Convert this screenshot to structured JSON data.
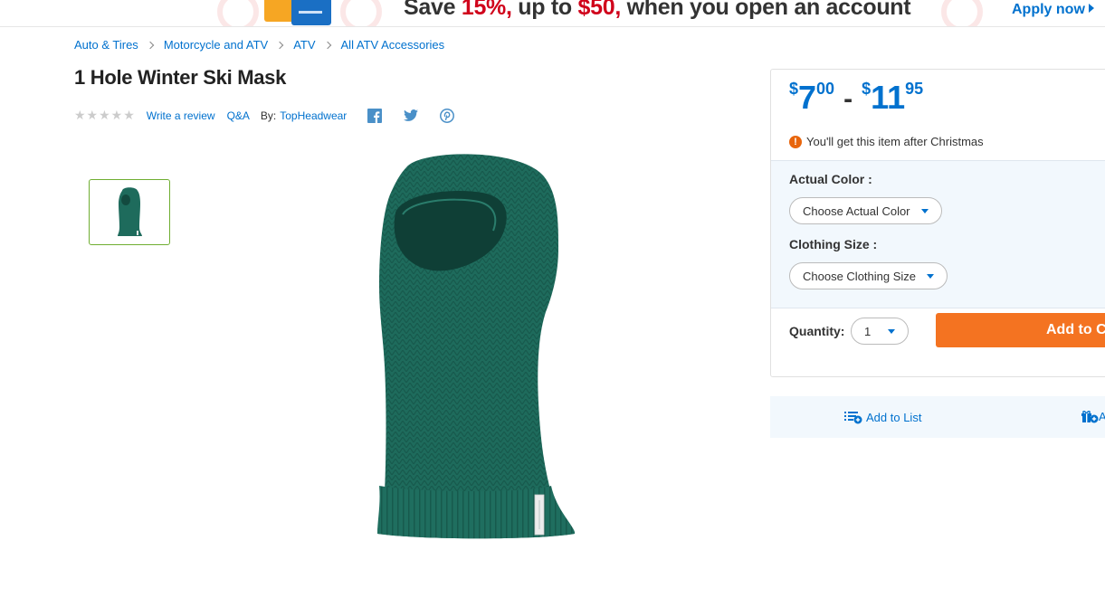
{
  "promo": {
    "text_before": "Save ",
    "percent": "15%,",
    "text_mid": " up to ",
    "amount": "$50,",
    "text_after": " when you open an account",
    "apply_label": "Apply now"
  },
  "breadcrumb": [
    "Auto & Tires",
    "Motorcycle and ATV",
    "ATV",
    "All ATV Accessories"
  ],
  "product": {
    "title": "1 Hole Winter Ski Mask",
    "stars": "★★★★★",
    "write_review": "Write a review",
    "qa": "Q&A",
    "by_label": "By:",
    "brand": "TopHeadwear"
  },
  "price": {
    "currency": "$",
    "low_dollars": "7",
    "low_cents": "00",
    "separator": "-",
    "high_dollars": "11",
    "high_cents": "95"
  },
  "shipping_note": "You'll get this item after Christmas",
  "alert_glyph": "!",
  "variants": {
    "color_label": "Actual Color :",
    "color_placeholder": "Choose Actual Color",
    "size_label": "Clothing Size :",
    "size_placeholder": "Choose Clothing Size"
  },
  "quantity": {
    "label": "Quantity:",
    "value": "1"
  },
  "add_to_cart": "Add to Ca",
  "add_to_list": "Add to List",
  "registry_partial": "A",
  "colors": {
    "brand_blue": "#0071ce",
    "cta_orange": "#f47321",
    "promo_red": "#d0021b",
    "mask_green": "#1e6b5c"
  }
}
